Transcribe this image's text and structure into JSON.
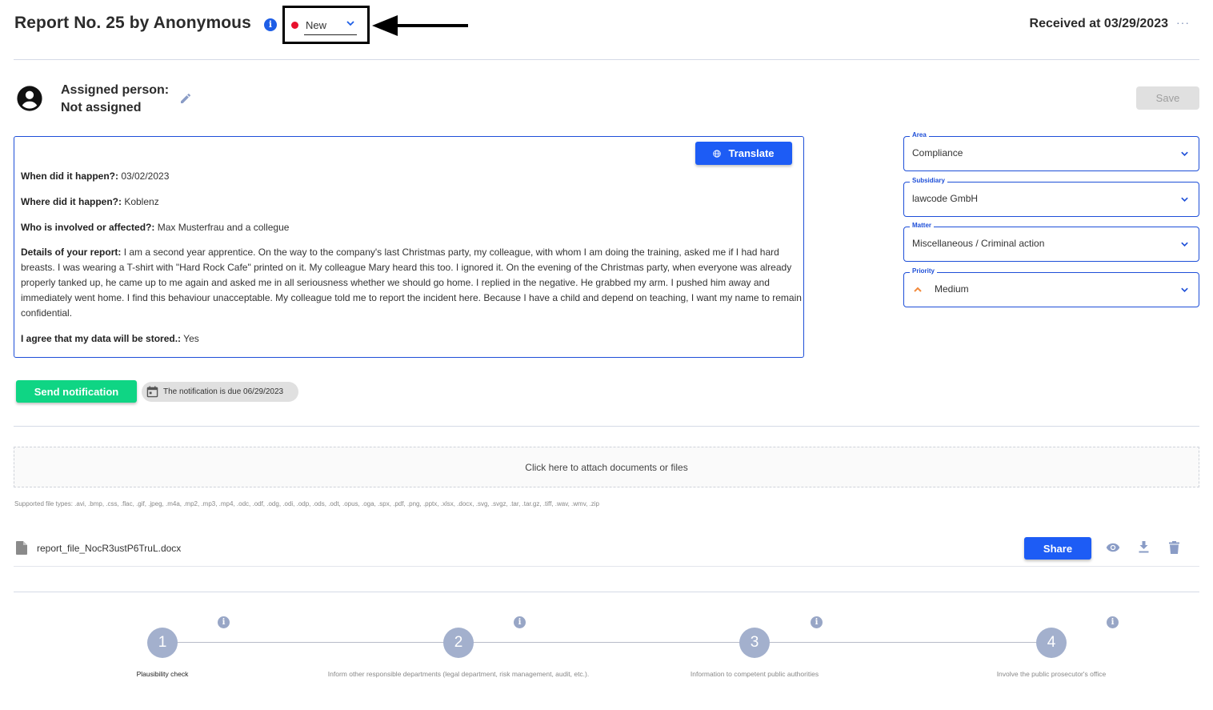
{
  "header": {
    "title": "Report No. 25 by Anonymous",
    "status": {
      "value": "New",
      "color": "#e8112d"
    },
    "received": "Received at 03/29/2023",
    "more_icon": "···"
  },
  "assignment": {
    "line1": "Assigned person:",
    "line2": "Not assigned"
  },
  "toolbar": {
    "save_label": "Save",
    "translate_label": "Translate"
  },
  "report": {
    "fields": [
      {
        "label": "When did it happen?:",
        "value": " 03/02/2023"
      },
      {
        "label": "Where did it happen?:",
        "value": " Koblenz"
      },
      {
        "label": "Who is involved or affected?:",
        "value": " Max Musterfrau and a collegue"
      },
      {
        "label": "Details of your report:",
        "value": " I am a second year apprentice. On the way to the company's last Christmas party, my colleague, with whom I am doing the training, asked me if I had hard breasts. I was wearing a T-shirt with \"Hard Rock Cafe\" printed on it. My colleague Mary heard this too. I ignored it. On the evening of the Christmas party, when everyone was already properly tanked up, he came up to me again and asked me in all seriousness whether we should go home. I replied in the negative. He grabbed my arm. I pushed him away and immediately went home. I find this behaviour unacceptable. My colleague told me to report the incident here. Because I have a child and depend on teaching, I want my name to remain confidential."
      },
      {
        "label": "I agree that my data will be stored.:",
        "value": " Yes"
      }
    ]
  },
  "notification": {
    "send_label": "Send notification",
    "due_text": "The notification is due 06/29/2023"
  },
  "upload": {
    "drop_text": "Click here to attach documents or files",
    "supported_types": "Supported file types: .avi, .bmp, .css, .flac, .gif, .jpeg, .m4a, .mp2, .mp3, .mp4, .odc, .odf, .odg, .odi, .odp, .ods, .odt, .opus, .oga, .spx, .pdf, .png, .pptx, .xlsx, .docx, .svg, .svgz, .tar, .tar.gz, .tiff, .wav, .wmv, .zip"
  },
  "files": [
    {
      "name": "report_file_NocR3ustP6TruL.docx",
      "share_label": "Share"
    }
  ],
  "fields": {
    "area": {
      "label": "Area",
      "value": "Compliance"
    },
    "subsidiary": {
      "label": "Subsidiary",
      "value": "lawcode GmbH"
    },
    "matter": {
      "label": "Matter",
      "value": "Miscellaneous / Criminal action"
    },
    "priority": {
      "label": "Priority",
      "value": "Medium",
      "color": "#f28a3c"
    }
  },
  "steps": [
    {
      "number": "1",
      "label": "Plausibility check"
    },
    {
      "number": "2",
      "label": "Inform other responsible departments (legal department, risk management, audit, etc.)."
    },
    {
      "number": "3",
      "label": "Information to competent public authorities"
    },
    {
      "number": "4",
      "label": "Involve the public prosecutor's office"
    }
  ],
  "colors": {
    "primary": "#1d5cf5",
    "success": "#0fd584",
    "border_accent": "#1e4fd8"
  }
}
